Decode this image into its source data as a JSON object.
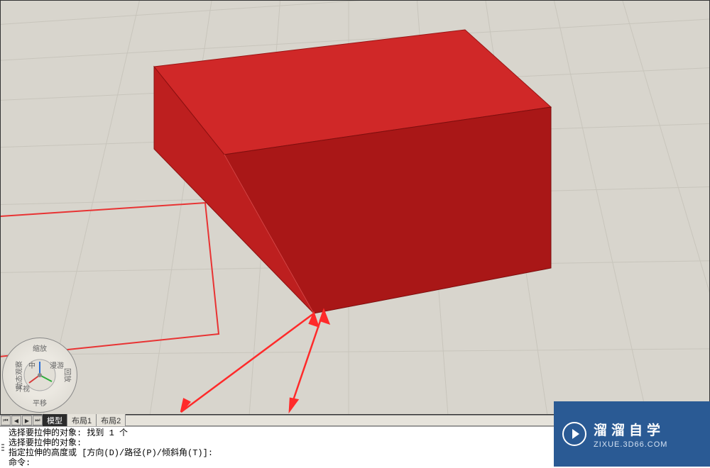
{
  "viewcube": {
    "zoom_label": "缩放",
    "pan_label": "平移",
    "orbit_label": "动态观察",
    "rewind_label": "回放",
    "inner_labels": [
      "中",
      "环视",
      "漫游"
    ]
  },
  "tabs": {
    "model": "模型",
    "layout1": "布局1",
    "layout2": "布局2"
  },
  "command": {
    "line1": "选择要拉伸的对象: 找到 1 个",
    "line2": "选择要拉伸的对象:",
    "line3": "指定拉伸的高度或 [方向(D)/路径(P)/倾斜角(T)]:",
    "prompt": "命令:"
  },
  "watermark": {
    "title": "溜溜自学",
    "url": "ZIXUE.3D66.COM"
  },
  "colors": {
    "solid_primary": "#c41e1e",
    "solid_front": "#b21a1a",
    "solid_side": "#981515",
    "solid_top": "#d62f2f",
    "wire_red": "#e83333",
    "viewport_bg": "#d8d5cd",
    "grid_line": "#c8c5bc",
    "brand_blue": "#2a5a94"
  }
}
